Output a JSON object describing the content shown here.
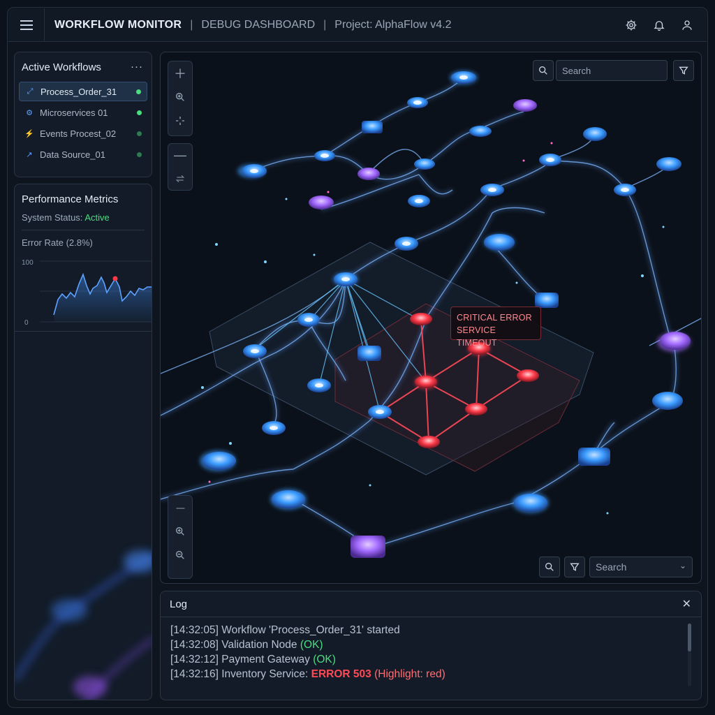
{
  "header": {
    "title": "WORKFLOW MONITOR",
    "sep1": "|",
    "section": "DEBUG DASHBOARD",
    "sep2": "|",
    "project": "Project: AlphaFlow v4.2"
  },
  "workflows": {
    "title": "Active Workflows",
    "more": "···",
    "items": [
      {
        "label": "Process_Order_31",
        "icon": "flow-icon",
        "status": "#4ade80"
      },
      {
        "label": "Microservices 01",
        "icon": "gear-icon",
        "status": "#4ade80"
      },
      {
        "label": "Events Procest_02",
        "icon": "bolt-icon",
        "status": "#2f7a52"
      },
      {
        "label": "Data Source_01",
        "icon": "chart-icon",
        "status": "#2f7a52"
      }
    ]
  },
  "performance": {
    "title": "Performance Metrics",
    "status_label": "System Status: ",
    "status_value": "Active",
    "error_rate_label": "Error Rate (2.8%)",
    "y_max": "100",
    "y_min": "0"
  },
  "canvas": {
    "search_top_placeholder": "Search",
    "search_bottom_placeholder": "Search",
    "error_line1": "CRITICAL ERROR",
    "error_line2": "SERVICE TIMEOUT",
    "colors": {
      "node": "#3a9bff",
      "node_alt": "#a36bff",
      "error": "#ff3b4a",
      "edge": "#6aa8ff"
    }
  },
  "log": {
    "title": "Log",
    "close": "✕",
    "lines": [
      {
        "prefix": "[14:32:05] Workflow 'Process_Order_31' started"
      },
      {
        "prefix": "[14:32:08] Validation Node ",
        "status": "(OK)"
      },
      {
        "prefix": "[14:32:12] Payment Gateway ",
        "status": "(OK)"
      },
      {
        "prefix": "[14:32:16] Inventory Service: ",
        "error": "ERROR 503",
        "note": " (Highlight: red)"
      }
    ]
  }
}
